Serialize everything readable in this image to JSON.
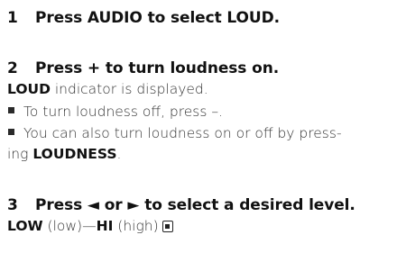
{
  "steps": [
    {
      "number": "1",
      "heading": "Press AUDIO to select LOUD."
    },
    {
      "number": "2",
      "heading": "Press + to turn loudness on.",
      "result_bold": "LOUD",
      "result_text": " indicator is displayed.",
      "bullets": [
        {
          "text": "To turn loudness off, press –."
        },
        {
          "line1": "You can also turn loudness on or off by press-",
          "line2_prefix": "ing ",
          "line2_bold": "LOUDNESS",
          "line2_suffix": "."
        }
      ]
    },
    {
      "number": "3",
      "heading": "Press ◄ or ► to select a desired level.",
      "range": {
        "low_bold": "LOW",
        "low_text": " (low)—",
        "hi_bold": "HI",
        "hi_text": " (high)"
      }
    }
  ],
  "icons": {
    "bullet": "square-bullet-icon",
    "end_mark": "end-of-section-icon"
  }
}
